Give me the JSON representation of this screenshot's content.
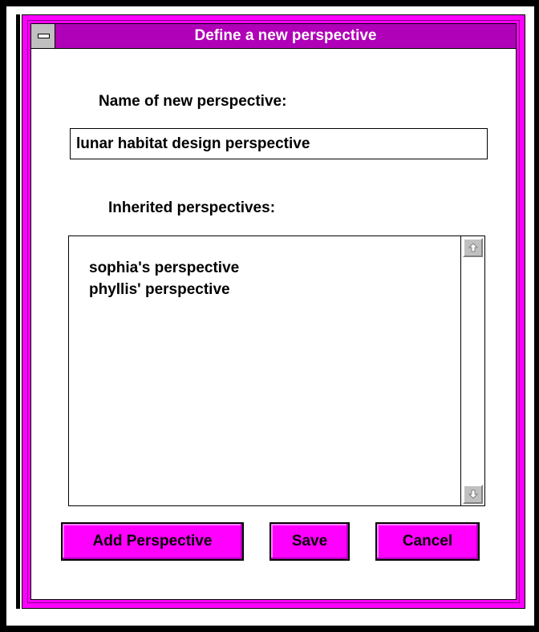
{
  "window": {
    "title": "Define a new perspective"
  },
  "form": {
    "name_label": "Name of new perspective:",
    "name_value": "lunar habitat design perspective",
    "inherited_label": "Inherited perspectives:",
    "inherited_items": [
      "sophia's perspective",
      "phyllis' perspective"
    ]
  },
  "buttons": {
    "add_label": "Add Perspective",
    "save_label": "Save",
    "cancel_label": "Cancel"
  },
  "colors": {
    "frame_accent": "#ff00ff",
    "title_bar": "#b000b8",
    "button_face": "#ff00ff"
  },
  "icons": {
    "system_menu": "system-menu-icon",
    "scroll_up": "scroll-up-arrow-icon",
    "scroll_down": "scroll-down-arrow-icon"
  }
}
